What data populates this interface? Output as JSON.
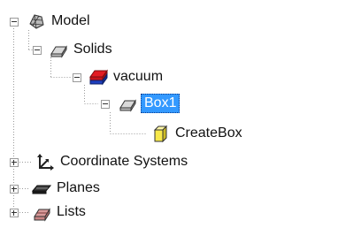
{
  "tree": {
    "nodes": [
      {
        "id": "model",
        "label": "Model",
        "icon": "model-icon",
        "expanded": true
      },
      {
        "id": "solids",
        "label": "Solids",
        "icon": "solid-shape-icon",
        "expanded": true
      },
      {
        "id": "vacuum",
        "label": "vacuum",
        "icon": "material-icon",
        "expanded": true
      },
      {
        "id": "box1",
        "label": "Box1",
        "icon": "box-shape-icon",
        "expanded": true,
        "selected": true
      },
      {
        "id": "createbox",
        "label": "CreateBox",
        "icon": "create-operation-icon"
      },
      {
        "id": "coordinate-systems",
        "label": "Coordinate Systems",
        "icon": "coordinate-axes-icon",
        "expanded": false
      },
      {
        "id": "planes",
        "label": "Planes",
        "icon": "planes-icon",
        "expanded": false
      },
      {
        "id": "lists",
        "label": "Lists",
        "icon": "lists-icon",
        "expanded": false
      }
    ]
  },
  "colors": {
    "selection": "#3399ff",
    "selection_text": "#ffffff",
    "tree_lines": "#9a9a9a",
    "vacuum_red": "#e31b23",
    "vacuum_blue": "#1f3fbf",
    "create_yellow": "#f7e84a"
  }
}
